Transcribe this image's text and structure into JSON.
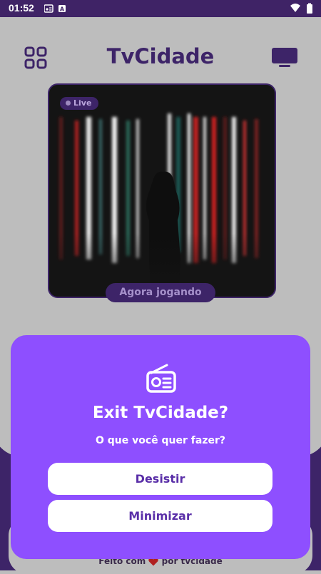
{
  "status_bar": {
    "time": "01:52"
  },
  "header": {
    "title": "TvCidade"
  },
  "player": {
    "live_label": "Live",
    "now_playing_label": "Agora jogando"
  },
  "footer": {
    "made_with": "Feito com",
    "by": "por tvcidade"
  },
  "dialog": {
    "title": "Exit TvCidade?",
    "subtitle": "O que você quer fazer?",
    "quit_label": "Desistir",
    "minimize_label": "Minimizar"
  },
  "colors": {
    "brand_purple": "#3d2468",
    "dialog_purple": "#8e4fff",
    "button_text": "#5a2fa8"
  },
  "icons": [
    "grid-icon",
    "tv-icon",
    "radio-icon",
    "heart-icon",
    "wifi-icon",
    "battery-icon"
  ]
}
